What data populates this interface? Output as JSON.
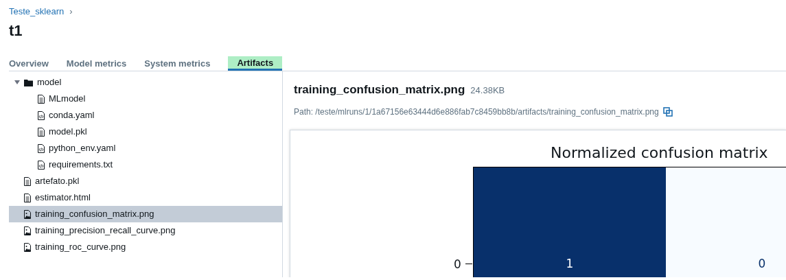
{
  "breadcrumb": {
    "label": "Teste_sklearn",
    "separator": "›"
  },
  "title": "t1",
  "tabs": [
    {
      "label": "Overview",
      "selected": false
    },
    {
      "label": "Model metrics",
      "selected": false
    },
    {
      "label": "System metrics",
      "selected": false
    },
    {
      "label": "Artifacts",
      "selected": true
    }
  ],
  "tree": [
    {
      "label": "model",
      "kind": "folder",
      "expanded": true,
      "selected": false,
      "children": [
        {
          "label": "MLmodel",
          "kind": "text",
          "selected": false
        },
        {
          "label": "conda.yaml",
          "kind": "code",
          "selected": false
        },
        {
          "label": "model.pkl",
          "kind": "text",
          "selected": false
        },
        {
          "label": "python_env.yaml",
          "kind": "code",
          "selected": false
        },
        {
          "label": "requirements.txt",
          "kind": "code",
          "selected": false
        }
      ]
    },
    {
      "label": "artefato.pkl",
      "kind": "text",
      "selected": false
    },
    {
      "label": "estimator.html",
      "kind": "text",
      "selected": false
    },
    {
      "label": "training_confusion_matrix.png",
      "kind": "image",
      "selected": true
    },
    {
      "label": "training_precision_recall_curve.png",
      "kind": "image",
      "selected": false
    },
    {
      "label": "training_roc_curve.png",
      "kind": "image",
      "selected": false
    }
  ],
  "preview": {
    "filename": "training_confusion_matrix.png",
    "size": "24.38KB",
    "path": "Path: /teste/mlruns/1/1a67156e63444d6e886fab7c8459bb8b/artifacts/training_confusion_matrix.png",
    "image": {
      "title": "Normalized confusion matrix",
      "row_label": "0",
      "cells": [
        {
          "value": "1",
          "color": "#08306b"
        },
        {
          "value": "0",
          "color": "#f7fbff"
        }
      ]
    }
  }
}
